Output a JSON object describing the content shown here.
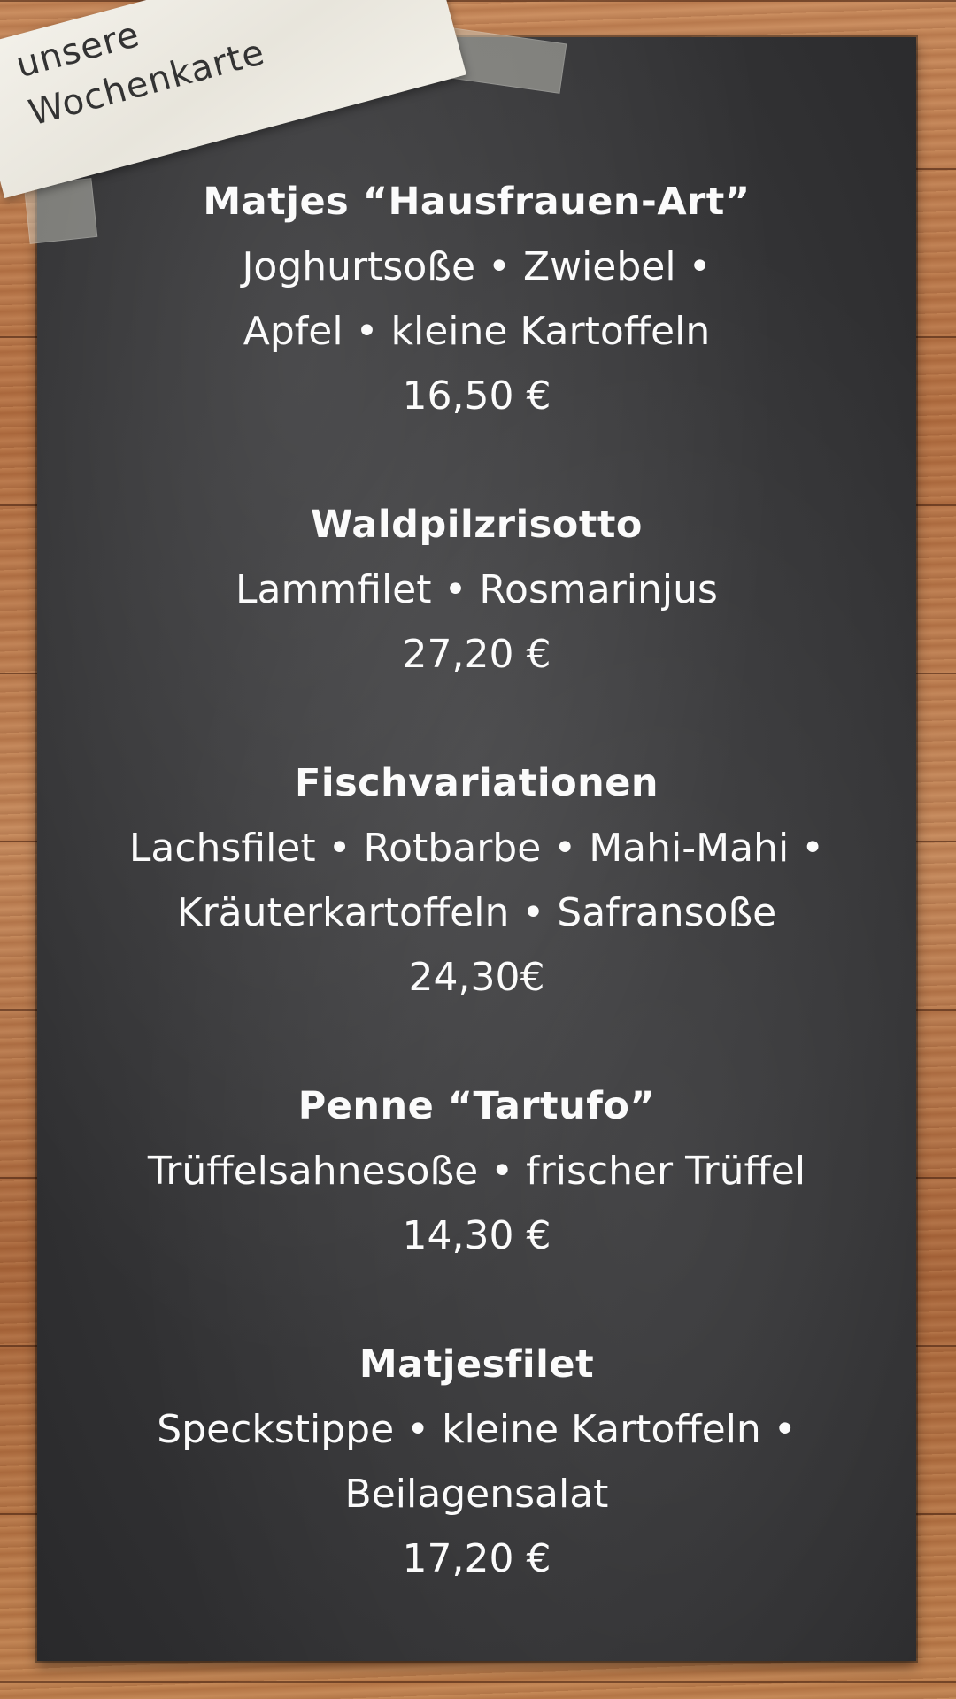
{
  "note": {
    "line1": "unsere",
    "line2": "Wochenkarte"
  },
  "dishes": [
    {
      "name": "Matjes “Hausfrauen-Art”",
      "lines": [
        "Joghurtsoße • Zwiebel •",
        "Apfel • kleine Kartoffeln"
      ],
      "price": "16,50 €"
    },
    {
      "name": "Waldpilzrisotto",
      "lines": [
        "Lammfilet • Rosmarinjus"
      ],
      "price": "27,20 €"
    },
    {
      "name": "Fischvariationen",
      "lines": [
        "Lachsfilet • Rotbarbe • Mahi-Mahi •",
        "Kräuterkartoffeln • Safransoße"
      ],
      "price": "24,30€"
    },
    {
      "name": "Penne “Tartufo”",
      "lines": [
        "Trüffelsahnesoße • frischer Trüffel"
      ],
      "price": "14,30 €"
    },
    {
      "name": "Matjesfilet",
      "lines": [
        "Speckstippe • kleine Kartoffeln •",
        "Beilagensalat"
      ],
      "price": "17,20 €"
    }
  ]
}
